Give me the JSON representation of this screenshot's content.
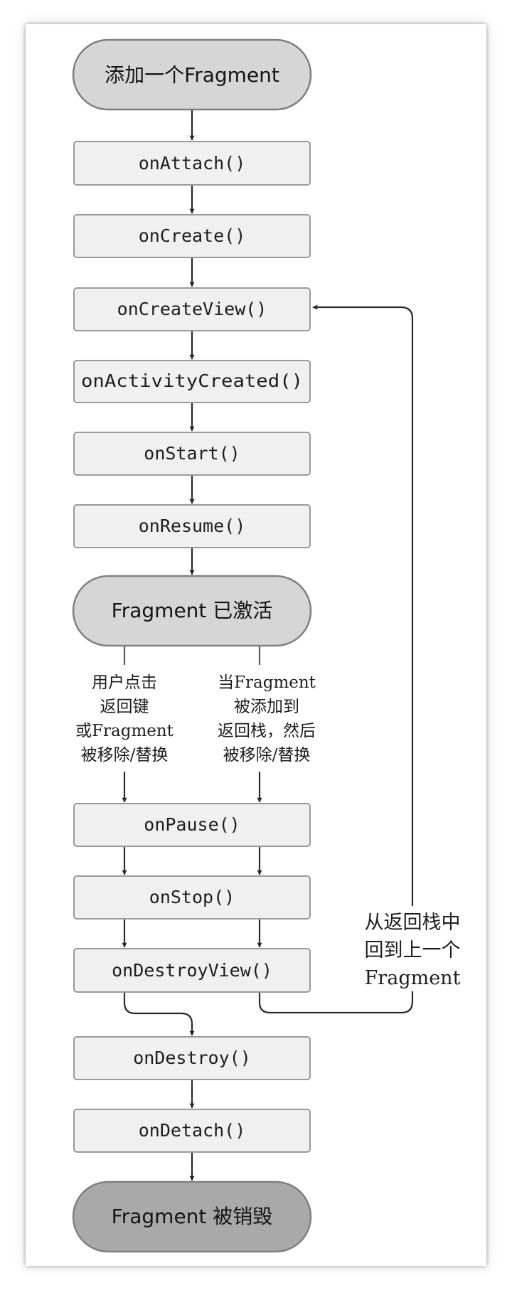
{
  "diagram": {
    "terminals": {
      "start": "添加一个Fragment",
      "active": "Fragment 已激活",
      "end": "Fragment 被销毁"
    },
    "callbacks": {
      "attach": "onAttach()",
      "create": "onCreate()",
      "create_view": "onCreateView()",
      "activity_created": "onActivityCreated()",
      "start": "onStart()",
      "resume": "onResume()",
      "pause": "onPause()",
      "stop": "onStop()",
      "destroy_view": "onDestroyView()",
      "destroy": "onDestroy()",
      "detach": "onDetach()"
    },
    "conditions": {
      "left": [
        "用户点击",
        "返回键",
        "或Fragment",
        "被移除/替换"
      ],
      "right": [
        "当Fragment",
        "被添加到",
        "返回栈，然后",
        "被移除/替换"
      ],
      "back_stack": [
        "从返回栈中",
        "回到上一个",
        "Fragment"
      ]
    },
    "colors": {
      "terminal_light": "#d6d6d6",
      "terminal_dark": "#a9a9a9",
      "box_fill": "#f0f0f0",
      "line": "#2a2a2a"
    }
  }
}
